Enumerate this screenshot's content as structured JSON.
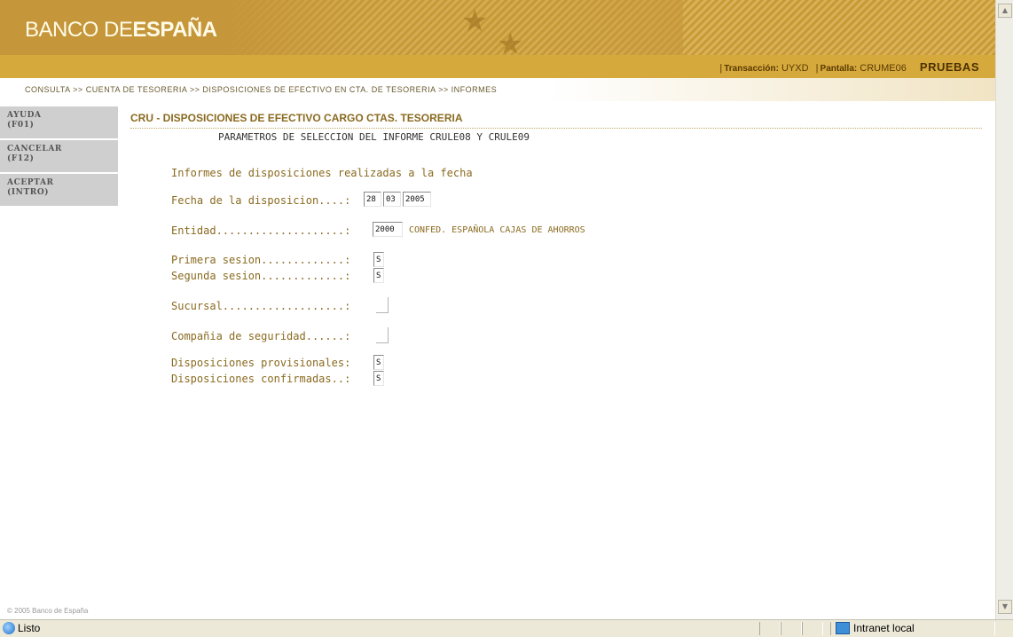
{
  "header": {
    "logo_light": "BANCO DE",
    "logo_bold": "ESPAÑA",
    "transaction_label": "Transacción:",
    "transaction_value": "UYXD",
    "screen_label": "Pantalla:",
    "screen_value": "CRUME06",
    "environment": "PRUEBAS"
  },
  "breadcrumb": "CONSULTA >> CUENTA DE TESORERIA >> DISPOSICIONES DE EFECTIVO EN CTA. DE TESORERIA >> INFORMES",
  "nav": [
    {
      "label": "AYUDA\n(F01)"
    },
    {
      "label": "CANCELAR\n(F12)"
    },
    {
      "label": "ACEPTAR\n(INTRO)"
    }
  ],
  "main": {
    "title": "CRU - DISPOSICIONES DE EFECTIVO CARGO CTAS. TESORERIA",
    "subtitle": "PARAMETROS DE SELECCION DEL INFORME CRULE08 Y CRULE09",
    "section_heading": "Informes de disposiciones realizadas a la fecha",
    "fecha_label": "Fecha de la disposicion....:",
    "fecha_day": "28",
    "fecha_month": "03",
    "fecha_year": "2005",
    "entidad_label": "Entidad....................:",
    "entidad_value": "2000",
    "entidad_desc": "CONFED. ESPAÑOLA CAJAS DE AHORROS",
    "primera_label": "Primera sesion.............:",
    "primera_value": "S",
    "segunda_label": "Segunda sesion.............:",
    "segunda_value": "S",
    "sucursal_label": "Sucursal...................:",
    "compania_label": "Compañia de seguridad......:",
    "provisionales_label": "Disposiciones provisionales:",
    "provisionales_value": "S",
    "confirmadas_label": "Disposiciones confirmadas..:",
    "confirmadas_value": "S"
  },
  "footer": {
    "copyright": "© 2005 Banco de España"
  },
  "statusbar": {
    "status": "Listo",
    "zone": "Intranet local"
  },
  "icons": {
    "status": "ie-page-icon",
    "zone": "intranet-zone-icon"
  },
  "colors": {
    "brand_gold": "#d6a93d",
    "text_gold": "#8a6a1f",
    "nav_gray": "#cfcfcf"
  }
}
